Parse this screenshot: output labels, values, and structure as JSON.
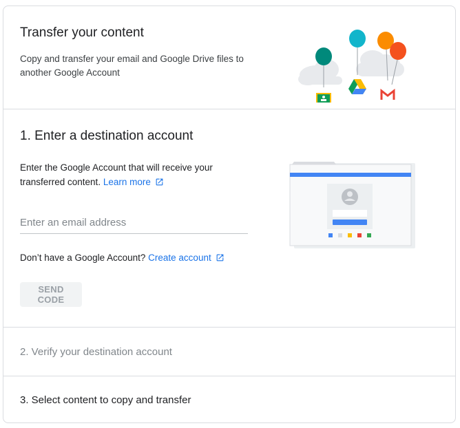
{
  "header": {
    "title": "Transfer your content",
    "subtitle": "Copy and transfer your email and Google Drive files to another Google Account"
  },
  "step1": {
    "title": "1. Enter a destination account",
    "description": "Enter the Google Account that will receive your transferred content.",
    "learn_more": "Learn more",
    "email_placeholder": "Enter an email address",
    "email_value": "",
    "no_account_text": "Don’t have a Google Account?",
    "create_account": "Create account",
    "send_code": "SEND CODE"
  },
  "step2": {
    "title": "2. Verify your destination account"
  },
  "step3": {
    "title": "3. Select content to copy and transfer"
  },
  "colors": {
    "link": "#1a73e8",
    "divider": "#dadce0",
    "disabled_button_bg": "#f1f3f4",
    "disabled_text": "#9aa0a6",
    "balloon_teal": "#00897b",
    "balloon_cyan": "#12b5cb",
    "balloon_orange": "#fb8c00",
    "balloon_red": "#f4511e"
  },
  "icons": [
    "open-in-new-icon",
    "google-classroom-icon",
    "google-drive-icon",
    "gmail-icon",
    "user-avatar-icon"
  ]
}
